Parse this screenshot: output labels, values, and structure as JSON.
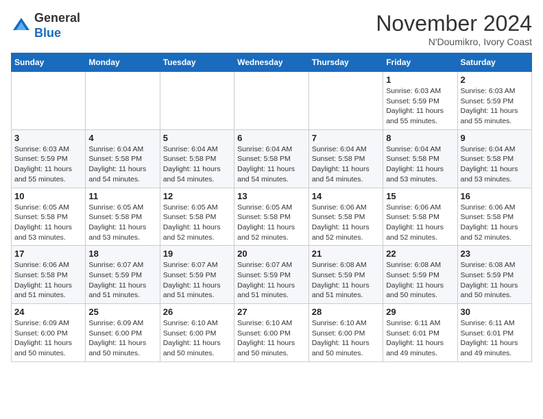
{
  "header": {
    "logo_general": "General",
    "logo_blue": "Blue",
    "month": "November 2024",
    "location": "N'Doumikro, Ivory Coast"
  },
  "weekdays": [
    "Sunday",
    "Monday",
    "Tuesday",
    "Wednesday",
    "Thursday",
    "Friday",
    "Saturday"
  ],
  "weeks": [
    [
      {
        "day": "",
        "info": ""
      },
      {
        "day": "",
        "info": ""
      },
      {
        "day": "",
        "info": ""
      },
      {
        "day": "",
        "info": ""
      },
      {
        "day": "",
        "info": ""
      },
      {
        "day": "1",
        "info": "Sunrise: 6:03 AM\nSunset: 5:59 PM\nDaylight: 11 hours and 55 minutes."
      },
      {
        "day": "2",
        "info": "Sunrise: 6:03 AM\nSunset: 5:59 PM\nDaylight: 11 hours and 55 minutes."
      }
    ],
    [
      {
        "day": "3",
        "info": "Sunrise: 6:03 AM\nSunset: 5:59 PM\nDaylight: 11 hours and 55 minutes."
      },
      {
        "day": "4",
        "info": "Sunrise: 6:04 AM\nSunset: 5:58 PM\nDaylight: 11 hours and 54 minutes."
      },
      {
        "day": "5",
        "info": "Sunrise: 6:04 AM\nSunset: 5:58 PM\nDaylight: 11 hours and 54 minutes."
      },
      {
        "day": "6",
        "info": "Sunrise: 6:04 AM\nSunset: 5:58 PM\nDaylight: 11 hours and 54 minutes."
      },
      {
        "day": "7",
        "info": "Sunrise: 6:04 AM\nSunset: 5:58 PM\nDaylight: 11 hours and 54 minutes."
      },
      {
        "day": "8",
        "info": "Sunrise: 6:04 AM\nSunset: 5:58 PM\nDaylight: 11 hours and 53 minutes."
      },
      {
        "day": "9",
        "info": "Sunrise: 6:04 AM\nSunset: 5:58 PM\nDaylight: 11 hours and 53 minutes."
      }
    ],
    [
      {
        "day": "10",
        "info": "Sunrise: 6:05 AM\nSunset: 5:58 PM\nDaylight: 11 hours and 53 minutes."
      },
      {
        "day": "11",
        "info": "Sunrise: 6:05 AM\nSunset: 5:58 PM\nDaylight: 11 hours and 53 minutes."
      },
      {
        "day": "12",
        "info": "Sunrise: 6:05 AM\nSunset: 5:58 PM\nDaylight: 11 hours and 52 minutes."
      },
      {
        "day": "13",
        "info": "Sunrise: 6:05 AM\nSunset: 5:58 PM\nDaylight: 11 hours and 52 minutes."
      },
      {
        "day": "14",
        "info": "Sunrise: 6:06 AM\nSunset: 5:58 PM\nDaylight: 11 hours and 52 minutes."
      },
      {
        "day": "15",
        "info": "Sunrise: 6:06 AM\nSunset: 5:58 PM\nDaylight: 11 hours and 52 minutes."
      },
      {
        "day": "16",
        "info": "Sunrise: 6:06 AM\nSunset: 5:58 PM\nDaylight: 11 hours and 52 minutes."
      }
    ],
    [
      {
        "day": "17",
        "info": "Sunrise: 6:06 AM\nSunset: 5:58 PM\nDaylight: 11 hours and 51 minutes."
      },
      {
        "day": "18",
        "info": "Sunrise: 6:07 AM\nSunset: 5:59 PM\nDaylight: 11 hours and 51 minutes."
      },
      {
        "day": "19",
        "info": "Sunrise: 6:07 AM\nSunset: 5:59 PM\nDaylight: 11 hours and 51 minutes."
      },
      {
        "day": "20",
        "info": "Sunrise: 6:07 AM\nSunset: 5:59 PM\nDaylight: 11 hours and 51 minutes."
      },
      {
        "day": "21",
        "info": "Sunrise: 6:08 AM\nSunset: 5:59 PM\nDaylight: 11 hours and 51 minutes."
      },
      {
        "day": "22",
        "info": "Sunrise: 6:08 AM\nSunset: 5:59 PM\nDaylight: 11 hours and 50 minutes."
      },
      {
        "day": "23",
        "info": "Sunrise: 6:08 AM\nSunset: 5:59 PM\nDaylight: 11 hours and 50 minutes."
      }
    ],
    [
      {
        "day": "24",
        "info": "Sunrise: 6:09 AM\nSunset: 6:00 PM\nDaylight: 11 hours and 50 minutes."
      },
      {
        "day": "25",
        "info": "Sunrise: 6:09 AM\nSunset: 6:00 PM\nDaylight: 11 hours and 50 minutes."
      },
      {
        "day": "26",
        "info": "Sunrise: 6:10 AM\nSunset: 6:00 PM\nDaylight: 11 hours and 50 minutes."
      },
      {
        "day": "27",
        "info": "Sunrise: 6:10 AM\nSunset: 6:00 PM\nDaylight: 11 hours and 50 minutes."
      },
      {
        "day": "28",
        "info": "Sunrise: 6:10 AM\nSunset: 6:00 PM\nDaylight: 11 hours and 50 minutes."
      },
      {
        "day": "29",
        "info": "Sunrise: 6:11 AM\nSunset: 6:01 PM\nDaylight: 11 hours and 49 minutes."
      },
      {
        "day": "30",
        "info": "Sunrise: 6:11 AM\nSunset: 6:01 PM\nDaylight: 11 hours and 49 minutes."
      }
    ]
  ]
}
